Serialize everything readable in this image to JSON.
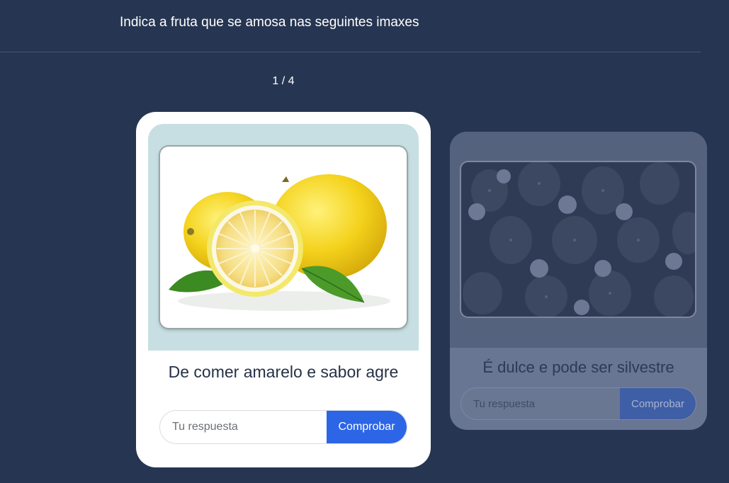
{
  "header": {
    "title": "Indica a fruta que se amosa nas seguintes imaxes"
  },
  "progress": {
    "counter": "1 / 4"
  },
  "cards": [
    {
      "image_subject": "lemons",
      "clue": "De comer amarelo e sabor agre",
      "input_placeholder": "Tu respuesta",
      "button_label": "Comprobar"
    },
    {
      "image_subject": "strawberries",
      "clue": "É dulce e pode ser silvestre",
      "input_placeholder": "Tu respuesta",
      "button_label": "Comprobar"
    }
  ],
  "colors": {
    "background": "#263551",
    "accent": "#2c66e6",
    "card_media": "#c7dfe3"
  }
}
